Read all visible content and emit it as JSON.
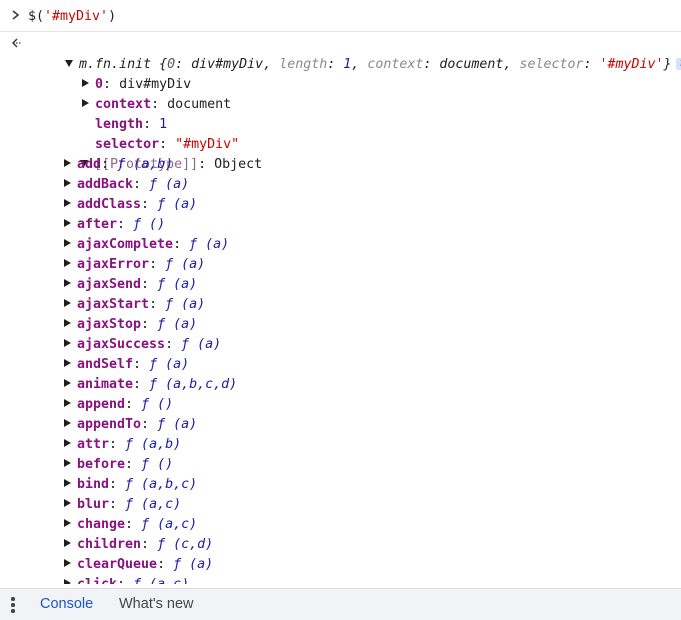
{
  "input": {
    "prefix": "$(",
    "string": "'#myDiv'",
    "suffix": ")"
  },
  "summary": {
    "constructor": "m.fn.init",
    "open_brace": " {",
    "k0": "0",
    "v0": "div#myDiv",
    "k_length": "length",
    "v_length": "1",
    "k_context": "context",
    "v_context": "document",
    "k_selector": "selector",
    "v_selector": "'#myDiv'",
    "close_brace": "}",
    "info": "i"
  },
  "props": [
    {
      "key": "0",
      "value": "div#myDiv",
      "kind": "obj"
    },
    {
      "key": "context",
      "value": "document",
      "kind": "obj"
    },
    {
      "key": "length",
      "value": "1",
      "kind": "num"
    },
    {
      "key": "selector",
      "value": "\"#myDiv\"",
      "kind": "str"
    }
  ],
  "prototype": {
    "key": "[[Prototype]]",
    "value": "Object"
  },
  "methods": [
    {
      "name": "add",
      "sig": "ƒ (a,b)"
    },
    {
      "name": "addBack",
      "sig": "ƒ (a)"
    },
    {
      "name": "addClass",
      "sig": "ƒ (a)"
    },
    {
      "name": "after",
      "sig": "ƒ ()"
    },
    {
      "name": "ajaxComplete",
      "sig": "ƒ (a)"
    },
    {
      "name": "ajaxError",
      "sig": "ƒ (a)"
    },
    {
      "name": "ajaxSend",
      "sig": "ƒ (a)"
    },
    {
      "name": "ajaxStart",
      "sig": "ƒ (a)"
    },
    {
      "name": "ajaxStop",
      "sig": "ƒ (a)"
    },
    {
      "name": "ajaxSuccess",
      "sig": "ƒ (a)"
    },
    {
      "name": "andSelf",
      "sig": "ƒ (a)"
    },
    {
      "name": "animate",
      "sig": "ƒ (a,b,c,d)"
    },
    {
      "name": "append",
      "sig": "ƒ ()"
    },
    {
      "name": "appendTo",
      "sig": "ƒ (a)"
    },
    {
      "name": "attr",
      "sig": "ƒ (a,b)"
    },
    {
      "name": "before",
      "sig": "ƒ ()"
    },
    {
      "name": "bind",
      "sig": "ƒ (a,b,c)"
    },
    {
      "name": "blur",
      "sig": "ƒ (a,c)"
    },
    {
      "name": "change",
      "sig": "ƒ (a,c)"
    },
    {
      "name": "children",
      "sig": "ƒ (c,d)"
    },
    {
      "name": "clearQueue",
      "sig": "ƒ (a)"
    },
    {
      "name": "click",
      "sig": "ƒ (a,c)"
    }
  ],
  "drawer": {
    "console_tab": "Console",
    "whats_new_tab": "What's new"
  },
  "colors": {
    "key": "#881280",
    "string": "#c80000",
    "number": "#1a1aa6",
    "tab_active": "#1a57c8"
  }
}
